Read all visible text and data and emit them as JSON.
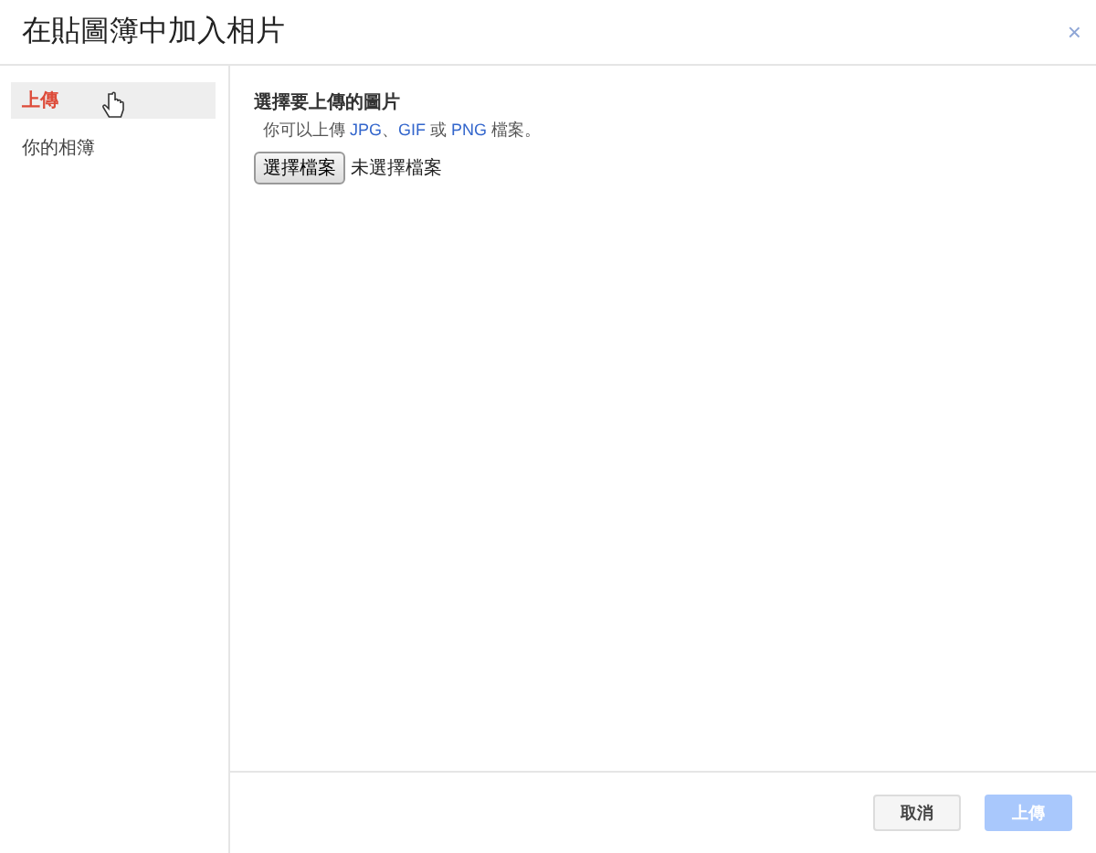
{
  "dialog": {
    "title": "在貼圖簿中加入相片",
    "close": "×"
  },
  "sidebar": {
    "items": [
      {
        "label": "上傳",
        "selected": true
      },
      {
        "label": "你的相簿",
        "selected": false
      }
    ]
  },
  "upload": {
    "heading": "選擇要上傳的圖片",
    "hint": [
      {
        "text": "你可以上傳 ",
        "highlight": false
      },
      {
        "text": "JPG",
        "highlight": true
      },
      {
        "text": "、",
        "highlight": false
      },
      {
        "text": "GIF",
        "highlight": true
      },
      {
        "text": " 或 ",
        "highlight": false
      },
      {
        "text": "PNG",
        "highlight": true
      },
      {
        "text": " 檔案。",
        "highlight": false
      }
    ],
    "file_button": "選擇檔案",
    "file_status": "未選擇檔案"
  },
  "buttons": [
    {
      "label": "取消",
      "kind": "secondary",
      "disabled": false
    },
    {
      "label": "上傳",
      "kind": "primary",
      "disabled": true
    }
  ]
}
